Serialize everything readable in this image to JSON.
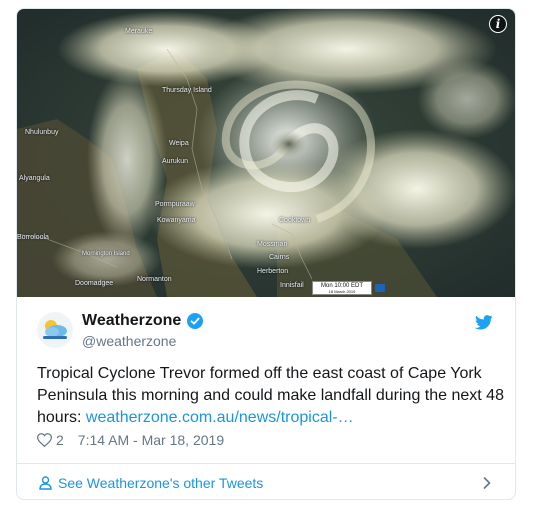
{
  "media": {
    "alt": "Satellite image of Tropical Cyclone Trevor",
    "places": {
      "weipa": "Weipa",
      "aurukun": "Aurukun",
      "thursday_island": "Thursday Island",
      "nhulunbuy": "Nhulunbuy",
      "alyangula": "Alyangula",
      "pormpuraaw": "Pormpuraaw",
      "kowanyama": "Kowanyama",
      "cooktown": "Cooktown",
      "mossman": "Mossman",
      "cairns": "Cairns",
      "herberton": "Herberton",
      "innisfail": "Innisfail",
      "borroloola": "Borroloola",
      "mornington": "Mornington Island",
      "normanton": "Normanton",
      "doomadgee": "Doomadgee",
      "merauke": "Merauke"
    },
    "timestamp_line1": "Mon 10:00 EDT",
    "timestamp_line2": "18 March 2019"
  },
  "account": {
    "name": "Weatherzone",
    "handle": "@weatherzone",
    "avatar_label": "weatherzone"
  },
  "tweet": {
    "text": "Tropical Cyclone Trevor formed off the east coast of Cape York Peninsula this morning and could make landfall during the next 48 hours: ",
    "link": "weatherzone.com.au/news/tropical-…",
    "likes": "2",
    "timestamp": "7:14 AM - Mar 18, 2019"
  },
  "footer": {
    "label": "See Weatherzone's other Tweets"
  },
  "colors": {
    "link": "#1b95e0",
    "verified": "#1da1f2",
    "twitter_bird": "#1da1f2",
    "muted": "#657786",
    "border": "#e1e8ed"
  }
}
